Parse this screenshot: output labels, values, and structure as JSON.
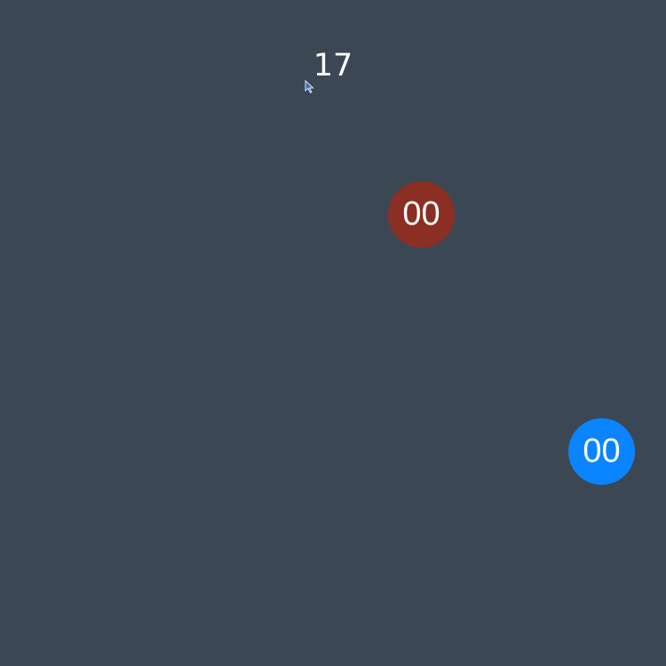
{
  "game": {
    "counter": "17"
  },
  "targets": [
    {
      "label": "00",
      "color": "#8b2e24"
    },
    {
      "label": "00",
      "color": "#0a84ff"
    }
  ],
  "colors": {
    "background": "#3c4754",
    "text": "#ffffff"
  },
  "cursor": {
    "icon": "mouse-pointer-icon"
  }
}
